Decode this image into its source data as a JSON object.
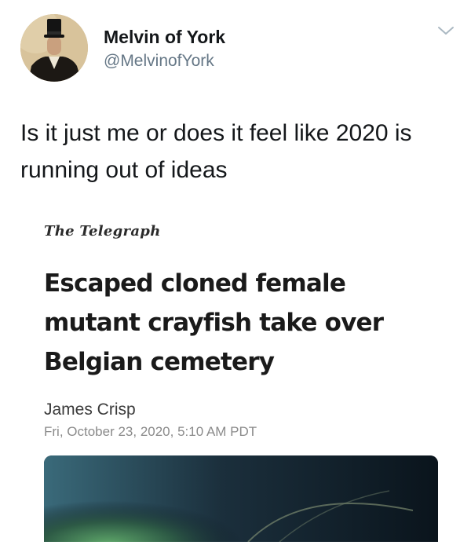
{
  "tweet": {
    "display_name": "Melvin of York",
    "handle": "@MelvinofYork",
    "text": "Is it just me or does it feel like 2020 is running out of ideas",
    "avatar_icon": "portrait-top-hat-gentleman",
    "menu_icon": "chevron-down-icon"
  },
  "article": {
    "publisher": "The Telegraph",
    "headline": "Escaped cloned female mutant crayfish take over Belgian cemetery",
    "author": "James Crisp",
    "date": "Fri, October 23, 2020, 5:10 AM PDT",
    "image_icon": "crayfish-underwater-photo"
  },
  "colors": {
    "name": "#14171a",
    "secondary": "#657786",
    "date": "#8a8a8a",
    "image_bg": "#0d1a24"
  }
}
